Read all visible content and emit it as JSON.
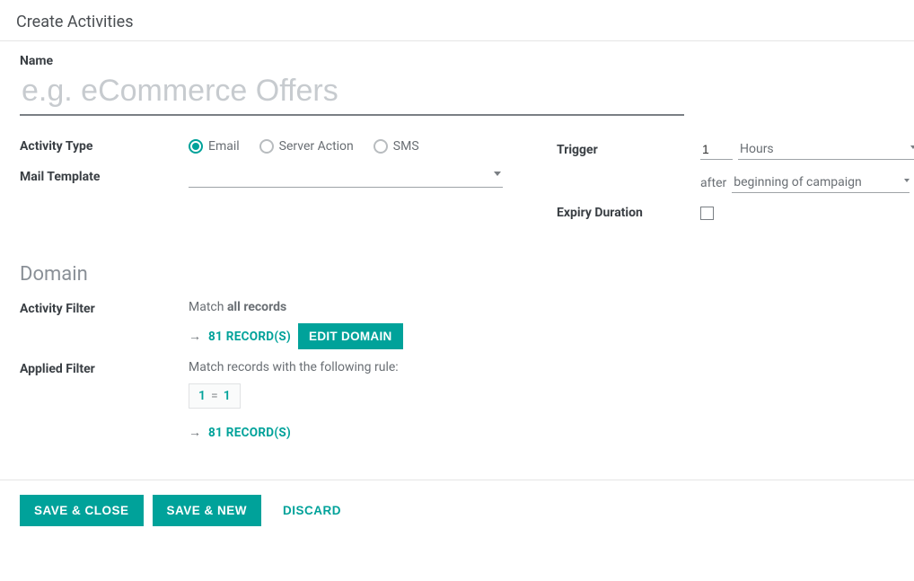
{
  "dialog": {
    "title": "Create Activities"
  },
  "name": {
    "label": "Name",
    "value": "",
    "placeholder": "e.g. eCommerce Offers"
  },
  "activity_type": {
    "label": "Activity Type",
    "options": [
      "Email",
      "Server Action",
      "SMS"
    ],
    "selected": "Email"
  },
  "mail_template": {
    "label": "Mail Template",
    "value": ""
  },
  "trigger": {
    "label": "Trigger",
    "value": "1",
    "unit": "Hours",
    "after_word": "after",
    "relative": "beginning of campaign"
  },
  "expiry": {
    "label": "Expiry Duration",
    "checked": false
  },
  "domain": {
    "section_title": "Domain",
    "activity_filter": {
      "label": "Activity Filter",
      "match_prefix": "Match ",
      "match_bold": "all records",
      "records_link": "81 RECORD(S)",
      "edit_btn": "EDIT DOMAIN"
    },
    "applied_filter": {
      "label": "Applied Filter",
      "desc": "Match records with the following rule:",
      "rule_lhs": "1",
      "rule_op": "=",
      "rule_rhs": "1",
      "records_link": "81 RECORD(S)"
    }
  },
  "footer": {
    "save_close": "SAVE & CLOSE",
    "save_new": "SAVE & NEW",
    "discard": "DISCARD"
  }
}
